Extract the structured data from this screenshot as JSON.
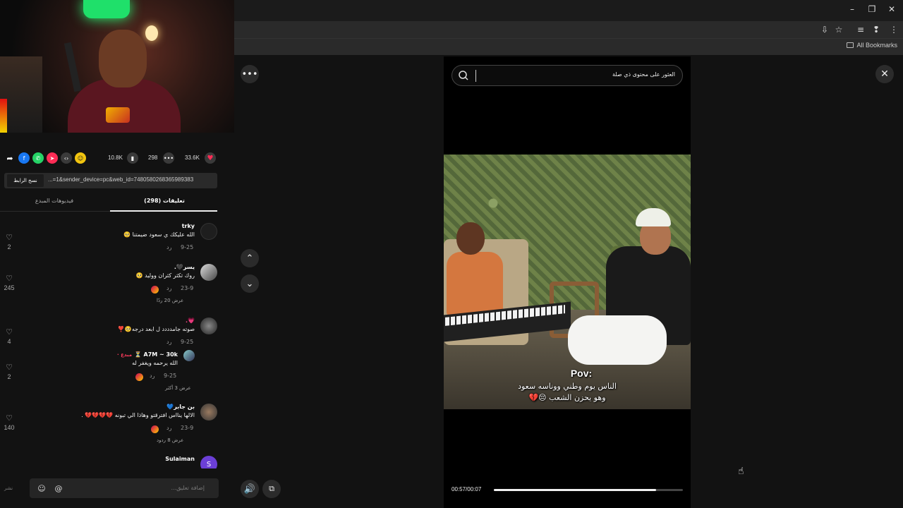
{
  "browser": {
    "bookmarks_label": "All Bookmarks",
    "window_controls": [
      "–",
      "❐",
      "✕"
    ]
  },
  "video_meta": {
    "likes": "33.6K",
    "comments": "298",
    "saves": "10.8K",
    "link_url": "...=1&sender_device=pc&web_id=7480580268365989383",
    "copy_link_label": "نسخ الرابط"
  },
  "tabs": {
    "comments_label": "(298) تعليقات",
    "creator_videos_label": "فيديوهات المبدع"
  },
  "comments": [
    {
      "user": "trky",
      "text": "الله عليكك ي سعود ضيمتنا 🥺",
      "date": "9-25",
      "reply": "رد",
      "likes": "2"
    },
    {
      "user": "يسر🖤.",
      "text": "روك تكثر كثران ووليد 🥺",
      "date": "23-9",
      "reply": "رد",
      "likes": "245",
      "more": "عرض 20 ردًا"
    },
    {
      "user": "💗.",
      "text": "صوته جامدددد ل ابعد درجه🥺❣️",
      "date": "9-25",
      "reply": "رد",
      "likes": "4"
    },
    {
      "user": "A7M ~ 30k ⏳",
      "creator_tag": "· مبدع",
      "text": "الله يرحمه ويغفر له",
      "date": "9-25",
      "reply": "رد",
      "likes": "2",
      "more": "عرض 3 أكثر"
    },
    {
      "user": "بن جابر💙",
      "text": "الالها ينااس افترقتو وهاذا الي تبونه 💔💔💔💔 .",
      "date": "23-9",
      "reply": "رد",
      "likes": "140",
      "more": "عرض 8 ردود"
    },
    {
      "user": "Sulaiman",
      "avatar_letter": "S"
    }
  ],
  "comment_input": {
    "placeholder": "إضافة تعليق...",
    "post_label": "نشر"
  },
  "player": {
    "search_placeholder": "العثور على محتوى ذي صلة",
    "caption_pov": "Pov:",
    "caption_line2": "الناس يوم وطني ووناسه سعود",
    "caption_line3": "وهو يحزن الشعب 😔💔",
    "time": "00:57/00:07",
    "progress": 0.86
  },
  "colors": {
    "accent_red": "#fe2c55",
    "background": "#121212"
  }
}
